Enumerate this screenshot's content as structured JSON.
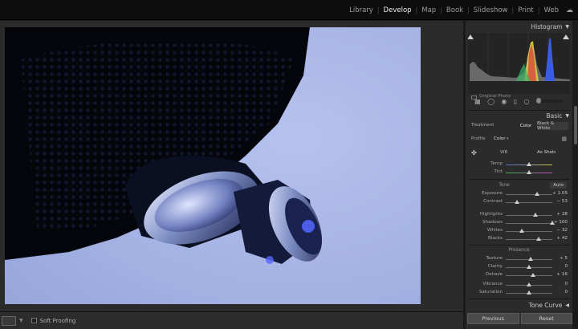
{
  "topbar": {
    "modules": [
      "Library",
      "Develop",
      "Map",
      "Book",
      "Slideshow",
      "Print",
      "Web"
    ],
    "active_module": "Develop"
  },
  "bottombar": {
    "soft_proofing_label": "Soft Proofing"
  },
  "histogram": {
    "title": "Histogram",
    "original_photo_label": "Original Photo"
  },
  "basic": {
    "title": "Basic",
    "treatment_label": "Treatment",
    "treatment_options": [
      "Color",
      "Black & White"
    ],
    "treatment_selected": "Color",
    "profile_label": "Profile",
    "profile_value": "Color",
    "wb_label": "WB",
    "wb_value": "As Shot",
    "temp_label": "Temp",
    "tint_label": "Tint",
    "tone_label": "Tone",
    "auto_label": "Auto",
    "presence_label": "Presence",
    "tone_sliders": [
      {
        "label": "Exposure",
        "value": "+ 1.05",
        "pos": 0.68
      },
      {
        "label": "Contrast",
        "value": "− 53",
        "pos": 0.24
      }
    ],
    "tone_sliders2": [
      {
        "label": "Highlights",
        "value": "+ 28",
        "pos": 0.64
      },
      {
        "label": "Shadows",
        "value": "+ 100",
        "pos": 1.0
      },
      {
        "label": "Whites",
        "value": "− 32",
        "pos": 0.34
      },
      {
        "label": "Blacks",
        "value": "+ 42",
        "pos": 0.71
      }
    ],
    "presence_sliders": [
      {
        "label": "Texture",
        "value": "+ 5",
        "pos": 0.53
      },
      {
        "label": "Clarity",
        "value": "0",
        "pos": 0.5
      },
      {
        "label": "Dehaze",
        "value": "+ 16",
        "pos": 0.58
      }
    ],
    "presence_sliders2": [
      {
        "label": "Vibrance",
        "value": "0",
        "pos": 0.5
      },
      {
        "label": "Saturation",
        "value": "0",
        "pos": 0.5
      }
    ]
  },
  "tone_curve": {
    "title": "Tone Curve"
  },
  "footer": {
    "previous_label": "Previous",
    "reset_label": "Reset"
  },
  "colors": {
    "active_module": "#efefef",
    "inactive_module": "#9c9c9c",
    "panel_bg": "#2b2b2b",
    "photo_bg": "#a9b7e6"
  }
}
